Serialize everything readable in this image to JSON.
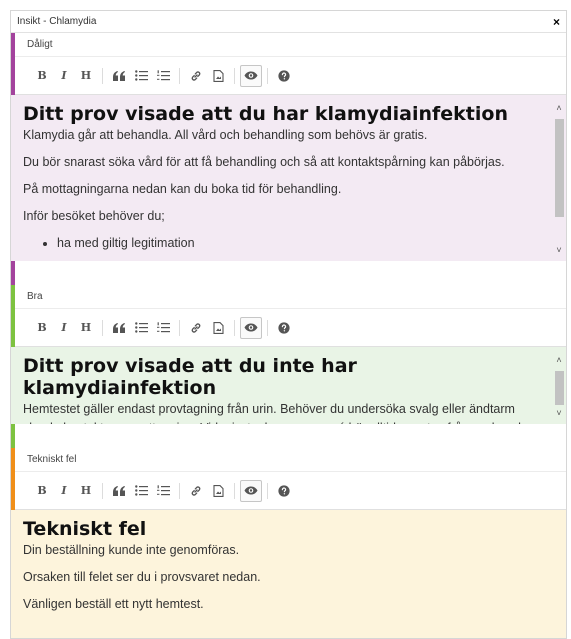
{
  "dialog": {
    "title": "Insikt - Chlamydia",
    "close_label": "×"
  },
  "toolbar_icons": [
    "bold-icon",
    "italic-icon",
    "heading-icon",
    "quote-icon",
    "unordered-list-icon",
    "ordered-list-icon",
    "link-icon",
    "image-icon",
    "preview-eye-icon",
    "help-icon"
  ],
  "colors": {
    "dåligt": "#a3439d",
    "bra": "#7dc240",
    "tekniskt_fel": "#f08f1a"
  },
  "sections": {
    "bad": {
      "label": "Dåligt",
      "heading": "Ditt prov visade att du har klamydiainfektion",
      "p1": "Klamydia går att behandla. All vård och behandling som behövs är gratis.",
      "p2": "Du bör snarast söka vård för att få behandling och så att kontaktspårning kan påbörjas.",
      "p3": "På mottagningarna nedan kan du boka tid för behandling.",
      "p4": "Inför besöket behöver du;",
      "li1": "ha med giltig legitimation"
    },
    "good": {
      "label": "Bra",
      "heading": "Ditt prov visade att du inte har klamydiainfektion",
      "p1": "Hemtestet gäller endast provtagning från urin. Behöver du undersöka svalg eller ändtarm ska du kontakta en mottagning. Vid misstanke om gonorré bör alltid prov tas från svalg och ändtarm för att utesluta smitta."
    },
    "error": {
      "label": "Tekniskt fel",
      "heading": "Tekniskt fel",
      "p1": "Din beställning kunde inte genomföras.",
      "p2": "Orsaken till felet ser du i provsvaret nedan.",
      "p3": "Vänligen beställ ett nytt hemtest."
    }
  }
}
